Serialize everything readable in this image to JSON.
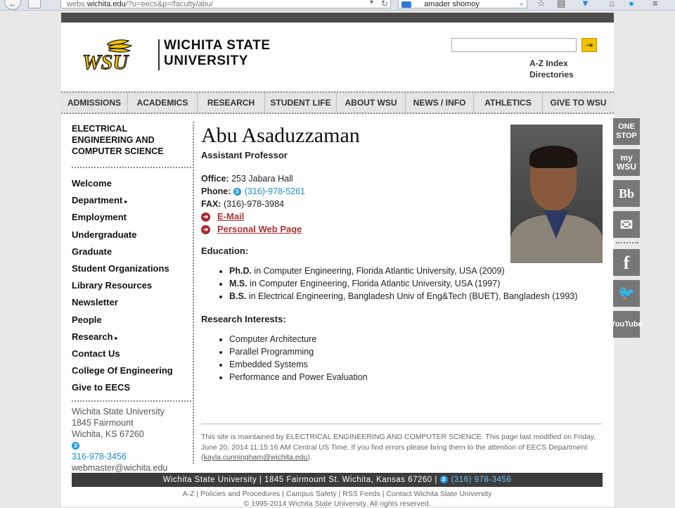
{
  "browser": {
    "back_glyph": "←",
    "url_prefix": "webs.",
    "url_domain": "wichita.edu",
    "url_path": "/?u=eecs&p=/faculty/abu/",
    "search_text": "amader shomoy",
    "toolbar_icons": [
      "dropdown-icon",
      "refresh-icon",
      "star-icon",
      "reading-list-icon",
      "pocket-icon",
      "home-icon",
      "skype-icon",
      "menu-icon"
    ]
  },
  "header": {
    "logo_mark": "WSU",
    "logo_line1": "WICHITA STATE",
    "logo_line2": "UNIVERSITY",
    "search_button": "⇥",
    "links": [
      "A-Z Index",
      "Directories"
    ]
  },
  "nav": [
    "ADMISSIONS",
    "ACADEMICS",
    "RESEARCH",
    "STUDENT LIFE",
    "ABOUT WSU",
    "NEWS / INFO",
    "ATHLETICS",
    "GIVE TO WSU"
  ],
  "sidebar": {
    "dept_lines": [
      "ELECTRICAL",
      "ENGINEERING AND",
      "COMPUTER SCIENCE"
    ],
    "items": [
      {
        "label": "Welcome",
        "arrow": ""
      },
      {
        "label": "Department",
        "arrow": "▸"
      },
      {
        "label": "Employment",
        "arrow": ""
      },
      {
        "label": "Undergraduate",
        "arrow": ""
      },
      {
        "label": "Graduate",
        "arrow": ""
      },
      {
        "label": "Student Organizations",
        "arrow": ""
      },
      {
        "label": "Library Resources",
        "arrow": ""
      },
      {
        "label": "Newsletter",
        "arrow": ""
      },
      {
        "label": "People",
        "arrow": ""
      },
      {
        "label": "Research",
        "arrow": "▸"
      },
      {
        "label": "Contact Us",
        "arrow": ""
      },
      {
        "label": "College Of Engineering",
        "arrow": ""
      },
      {
        "label": "Give to EECS",
        "arrow": ""
      }
    ],
    "contact": {
      "name": "Wichita State University",
      "street": "1845 Fairmount",
      "city": "Wichita, KS 67260",
      "phone": "316-978-3456",
      "email": "webmaster@wichita.edu"
    }
  },
  "profile": {
    "name": "Abu Asaduzzaman",
    "title": "Assistant Professor",
    "office_label": "Office:",
    "office": "253 Jabara Hall",
    "phone_label": "Phone:",
    "phone": "(316)-978-5261",
    "fax_label": "FAX:",
    "fax": "(316)-978-3984",
    "email_link": "E-Mail",
    "web_link": "Personal Web Page",
    "education_heading": "Education:",
    "education": [
      {
        "degree": "Ph.D.",
        "detail": " in Computer Engineering, Florida Atlantic University, USA (2009)"
      },
      {
        "degree": "M.S.",
        "detail": " in Computer Engineering, Florida Atlantic University, USA (1997)"
      },
      {
        "degree": "B.S.",
        "detail": " in Electrical Engineering, Bangladesh Univ of Eng&Tech (BUET), Bangladesh (1993)"
      }
    ],
    "research_heading": "Research Interests:",
    "research": [
      "Computer Architecture",
      "Parallel Programming",
      "Embedded Systems",
      "Performance and Power Evaluation"
    ]
  },
  "social": [
    "ONE STOP",
    "my WSU",
    "Bb",
    "email-icon",
    "facebook-icon",
    "twitter-icon",
    "YouTube"
  ],
  "footer": {
    "maintained_1": "This site is maintained by ELECTRICAL ENGINEERING AND COMPUTER SCIENCE. This page last modified on Friday, June 20, 2014 11:15:16 AM Central US Time. If you find errors please bring them to the attention of EECS Department (",
    "maintained_email": "kayla.cunningham@wichita.edu",
    "maintained_2": ").",
    "bar_text": "Wichita State University | 1845 Fairmount St. Wichita, Kansas 67260 |",
    "bar_phone": "(316) 978-3456",
    "links": "A-Z | Policies and Procedures | Campus Safety | RSS Feeds | Contact Wichita State University",
    "copyright": "© 1995-2014 Wichita State University. All rights reserved."
  }
}
